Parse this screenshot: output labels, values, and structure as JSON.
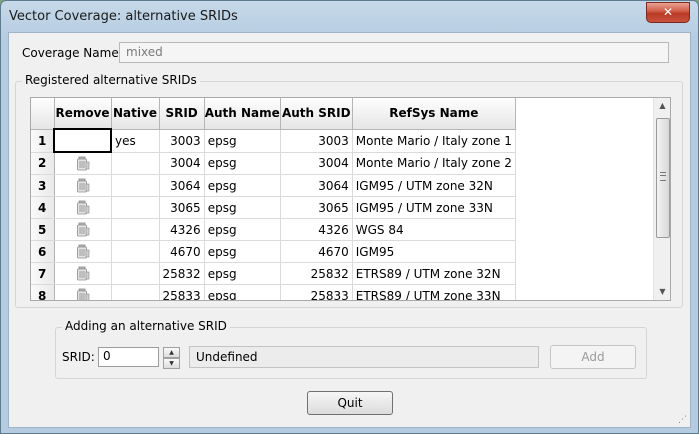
{
  "window": {
    "title": "Vector Coverage: alternative SRIDs",
    "close_glyph": "✕"
  },
  "coverage": {
    "label": "Coverage Name:",
    "value": "mixed"
  },
  "registered": {
    "legend": "Registered alternative SRIDs",
    "columns": [
      "Remove",
      "Native",
      "SRID",
      "Auth Name",
      "Auth SRID",
      "RefSys Name"
    ],
    "rows": [
      {
        "num": "1",
        "native": "yes",
        "srid": "3003",
        "auth_name": "epsg",
        "auth_srid": "3003",
        "refsys": "Monte Mario / Italy zone 1",
        "remove_icon": false
      },
      {
        "num": "2",
        "native": "",
        "srid": "3004",
        "auth_name": "epsg",
        "auth_srid": "3004",
        "refsys": "Monte Mario / Italy zone 2",
        "remove_icon": true
      },
      {
        "num": "3",
        "native": "",
        "srid": "3064",
        "auth_name": "epsg",
        "auth_srid": "3064",
        "refsys": "IGM95 / UTM zone 32N",
        "remove_icon": true
      },
      {
        "num": "4",
        "native": "",
        "srid": "3065",
        "auth_name": "epsg",
        "auth_srid": "3065",
        "refsys": "IGM95 / UTM zone 33N",
        "remove_icon": true
      },
      {
        "num": "5",
        "native": "",
        "srid": "4326",
        "auth_name": "epsg",
        "auth_srid": "4326",
        "refsys": "WGS 84",
        "remove_icon": true
      },
      {
        "num": "6",
        "native": "",
        "srid": "4670",
        "auth_name": "epsg",
        "auth_srid": "4670",
        "refsys": "IGM95",
        "remove_icon": true
      },
      {
        "num": "7",
        "native": "",
        "srid": "25832",
        "auth_name": "epsg",
        "auth_srid": "25832",
        "refsys": "ETRS89 / UTM zone 32N",
        "remove_icon": true
      },
      {
        "num": "8",
        "native": "",
        "srid": "25833",
        "auth_name": "epsg",
        "auth_srid": "25833",
        "refsys": "ETRS89 / UTM zone 33N",
        "remove_icon": true
      }
    ],
    "scroll_position": 0.0
  },
  "adding": {
    "legend": "Adding an alternative SRID",
    "srid_label": "SRID:",
    "srid_value": "0",
    "refsys_value": "Undefined",
    "add_label": "Add"
  },
  "quit_label": "Quit",
  "icons": {
    "remove": "trash-bin-icon",
    "scroll_up": "arrow-up-icon",
    "scroll_down": "arrow-down-icon"
  }
}
